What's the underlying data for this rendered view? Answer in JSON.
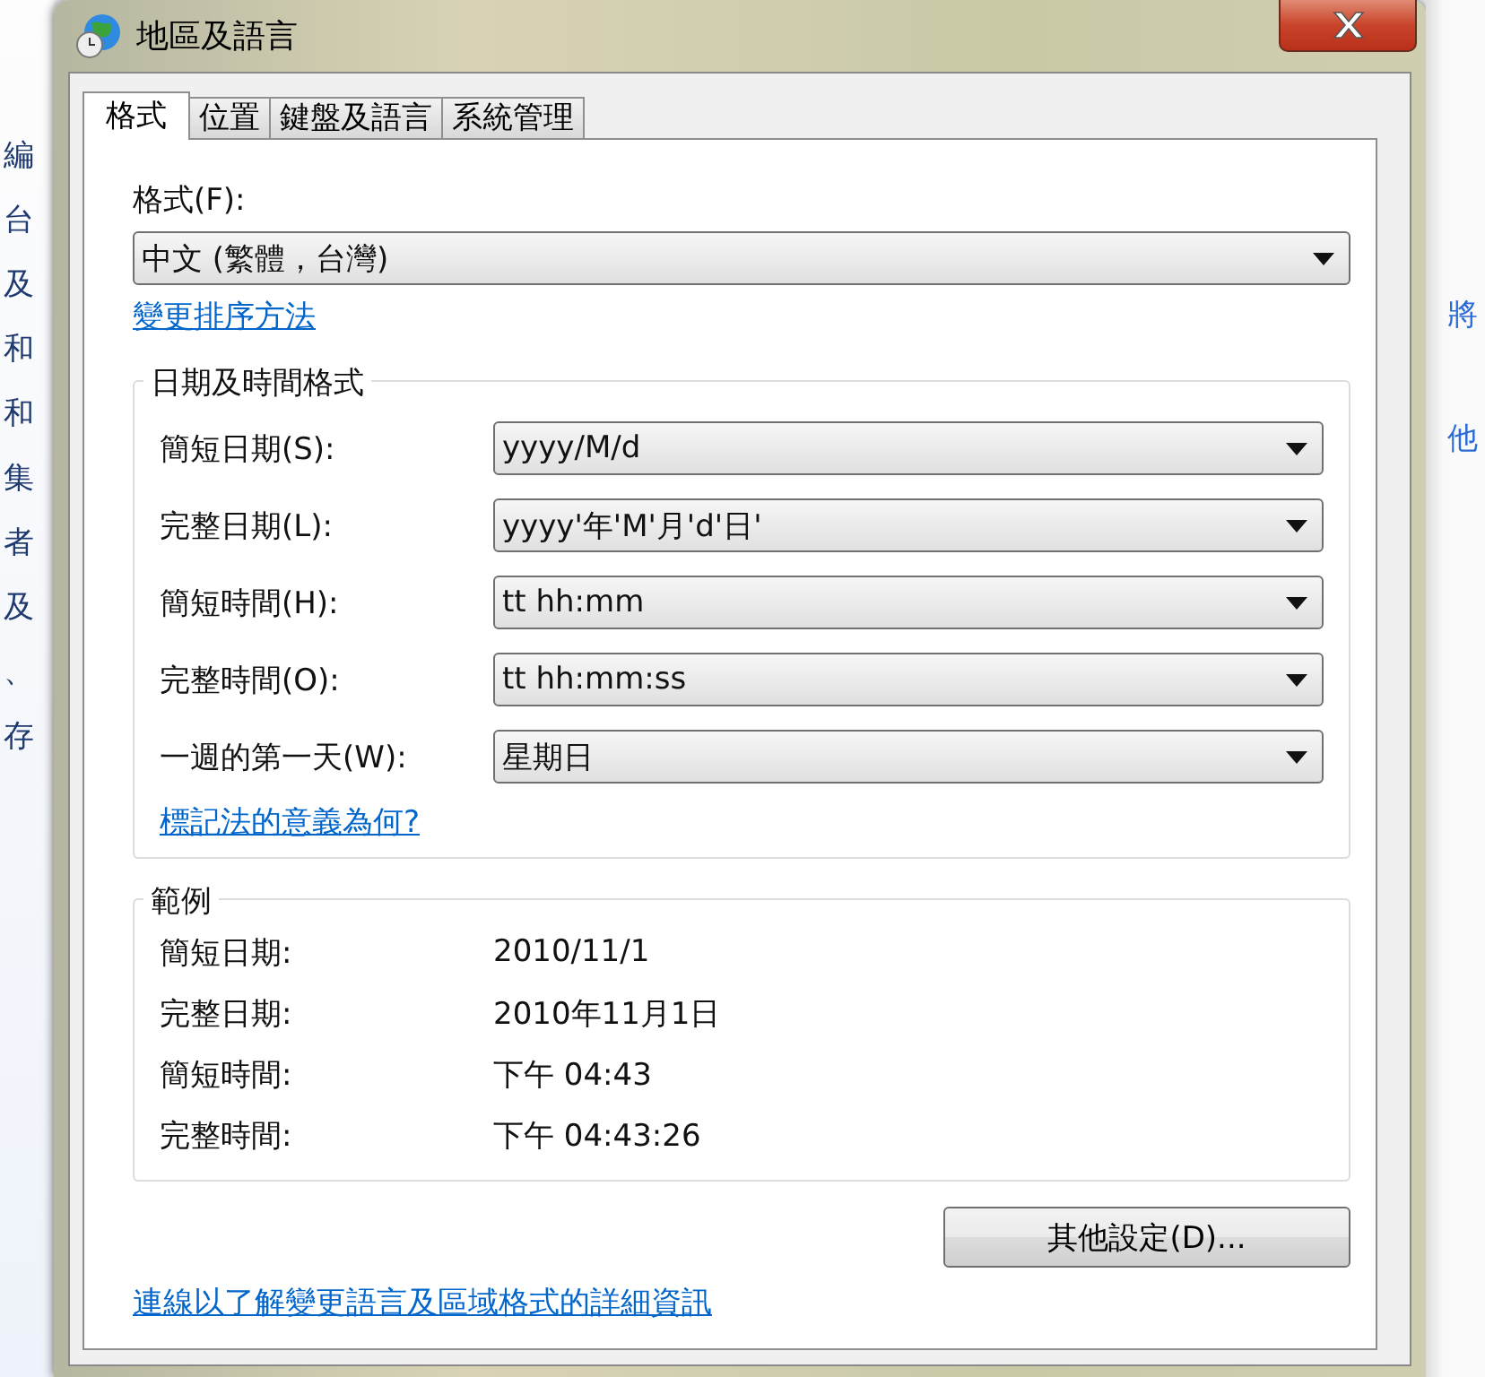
{
  "background_window": {
    "left_labels": [
      "編",
      "台",
      "及",
      "和",
      "和",
      "集",
      "者",
      "及",
      "、",
      "存"
    ],
    "right_labels": [
      "將",
      "他"
    ]
  },
  "window": {
    "title": "地區及語言"
  },
  "tabs": [
    {
      "label": "格式",
      "selected": true
    },
    {
      "label": "位置",
      "selected": false
    },
    {
      "label": "鍵盤及語言",
      "selected": false
    },
    {
      "label": "系統管理",
      "selected": false
    }
  ],
  "format": {
    "label": "格式(F):",
    "value": "中文 (繁體，台灣)"
  },
  "sort_link": "變更排序方法",
  "date_time_group": {
    "title": "日期及時間格式",
    "fields": [
      {
        "label": "簡短日期(S):",
        "value": "yyyy/M/d"
      },
      {
        "label": "完整日期(L):",
        "value": "yyyy'年'M'月'd'日'"
      },
      {
        "label": "簡短時間(H):",
        "value": "tt hh:mm"
      },
      {
        "label": "完整時間(O):",
        "value": "tt hh:mm:ss"
      },
      {
        "label": "一週的第一天(W):",
        "value": "星期日"
      }
    ],
    "help_link": "標記法的意義為何?"
  },
  "examples": {
    "title": "範例",
    "rows": [
      {
        "label": "簡短日期:",
        "value": "2010/11/1"
      },
      {
        "label": "完整日期:",
        "value": "2010年11月1日"
      },
      {
        "label": "簡短時間:",
        "value": "下午 04:43"
      },
      {
        "label": "完整時間:",
        "value": "下午 04:43:26"
      }
    ]
  },
  "additional_button": "其他設定(D)...",
  "info_link": "連線以了解變更語言及區域格式的詳細資訊"
}
